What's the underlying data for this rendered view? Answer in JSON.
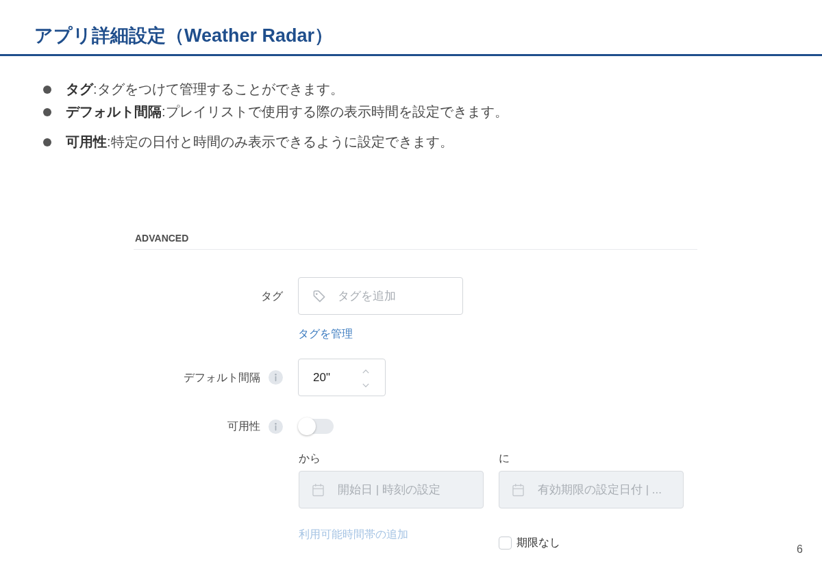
{
  "slide": {
    "title": "アプリ詳細設定（Weather Radar）",
    "page_number": "6"
  },
  "bullets": [
    {
      "text": "**タグ**:タグをつけて管理することができます。"
    },
    {
      "text": "**デフォルト間隔**:プレイリストで使用する際の表示時間を設定できます。"
    },
    {
      "text": "**可用性**:特定の日付と時間のみ表示できるように設定できます。"
    }
  ],
  "panel": {
    "section_title": "ADVANCED",
    "fields": [
      {
        "kind": "tags",
        "label": "タグ",
        "info_icon": false,
        "placeholder": "タグを追加",
        "link": "タグを管理"
      },
      {
        "kind": "number",
        "label": "デフォルト間隔",
        "info_icon": true,
        "value": "20\""
      },
      {
        "kind": "toggle",
        "label": "可用性",
        "info_icon": true,
        "on": false
      }
    ],
    "availability": {
      "from": {
        "label": "から",
        "placeholder": "開始日 | 時刻の設定",
        "disabled": true
      },
      "to": {
        "label": "に",
        "placeholder": "有効期限の設定日付 | ...",
        "disabled": true
      },
      "add_link": {
        "text": "利用可能時間帯の追加",
        "disabled": true
      },
      "no_expiry": {
        "label": "期限なし",
        "checked": false
      }
    }
  }
}
